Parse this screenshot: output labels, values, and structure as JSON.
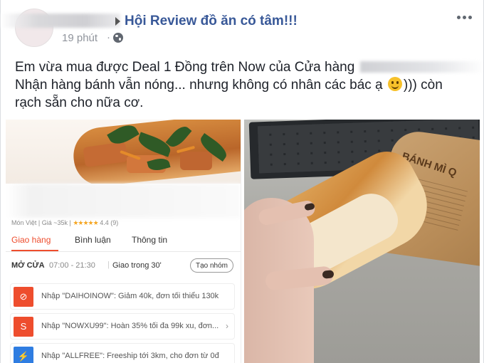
{
  "header": {
    "group_name": "Hội Review đồ ăn có tâm!!!",
    "time": "19 phút",
    "separator": "·",
    "privacy_icon": "globe-icon",
    "more_icon": "more-options-icon"
  },
  "post": {
    "line1": "Em vừa mua được Deal 1 Đồng trên Now của Cửa hàng",
    "line2_before": "Nhận hàng bánh vẫn nóng... nhưng không có nhân các bác ạ",
    "line2_after": "))) còn",
    "line3": "rạch sẵn cho nữa cơ.",
    "emoji": "smile-emoji-icon"
  },
  "app_screenshot": {
    "shop_meta": "Món Việt | Giá ~35k |",
    "stars": "★★★★★",
    "rating": "4.4 (9)",
    "tabs": [
      "Giao hàng",
      "Bình luận",
      "Thông tin"
    ],
    "hours_label": "MỞ CỬA",
    "hours": "07:00 - 21:30",
    "separator": "|",
    "delivery": "Giao trong 30'",
    "group_button": "Tạo nhóm",
    "promos": [
      {
        "icon_text": "⊘",
        "text": "Nhập \"DAIHOINOW\": Giảm 40k, đơn tối thiểu 130k",
        "color": "#ee4d2d"
      },
      {
        "icon_text": "S",
        "text": "Nhập \"NOWXU99\": Hoàn 35% tối đa 99k xu, đơn...",
        "color": "#ee4d2d"
      },
      {
        "icon_text": "⚡",
        "text": "Nhập \"ALLFREE\": Freeship tới 3km, cho đơn từ 0đ",
        "color": "#2f7de1"
      }
    ],
    "chevron": "›"
  },
  "photo": {
    "bag_text": "BÁNH MÌ Q"
  },
  "colors": {
    "group_link": "#385898",
    "accent": "#ee4d2d",
    "text": "#1d2129",
    "meta": "#90949c"
  }
}
